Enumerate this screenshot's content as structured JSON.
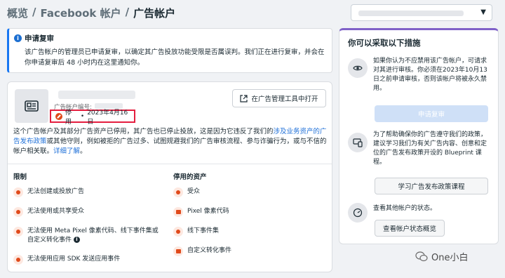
{
  "breadcrumb": {
    "item1": "概览",
    "sep1": "/",
    "item2": "Facebook 帐户",
    "sep2": "/",
    "current": "广告帐户"
  },
  "notice": {
    "title": "申请复审",
    "body": "该广告帐户的管理员已申请复审，以确定其广告投放功能受限是否属误判。我们正在进行复审，并会在你申请复审后 48 小时内在这里通知你。"
  },
  "account": {
    "id_label": "广告帐户编号:",
    "status": "停用",
    "dot": "•",
    "date": "2023年4月16日",
    "open_button": "在广告管理工具中打开",
    "desc_part1": "这个广告帐户及其部分广告资产已停用，其广告也已停止投放，这是因为它违反了我们的",
    "desc_link1": "涉及业务资产的广告发布政策",
    "desc_part2": "或其他守则，例如被拒的广告过多、试图规避我们的广告审核流程、参与诈骗行为，或与不信的帐户相关联。",
    "desc_link2": "详细了解",
    "desc_end": "。"
  },
  "restrictions": {
    "title": "限制",
    "items": [
      "无法创建或投放广告",
      "无法使用或共享受众",
      "无法使用 Meta Pixel 像素代码、线下事件集或自定义转化事件",
      "无法使用应用 SDK 发送应用事件"
    ]
  },
  "disabled_assets": {
    "title": "停用的资产",
    "items": [
      "受众",
      "Pixel 像素代码",
      "线下事件集",
      "自定义转化事件"
    ]
  },
  "side": {
    "title": "你可以采取以下措施",
    "text1": "如果你认为不应禁用该广告帐户，可请求对其进行审核。你必须在2023年10月13日之前申请审核，否则该帐户将被永久禁用。",
    "appeal_button": "申请复审",
    "text2": "为了帮助确保你的广告遵守我们的政策，建议学习我们为有关广告内容、创意和定位的广告发布政策开设的 Blueprint 课程。",
    "learn_button": "学习广告发布政策课程",
    "text3": "查看其他帐户的状态。",
    "status_button": "查看帐户状态概览"
  },
  "watermark": {
    "text": "One小白"
  },
  "colors": {
    "accent": "#1877f2",
    "danger": "#e04a1b",
    "purple": "#7f61c8"
  }
}
